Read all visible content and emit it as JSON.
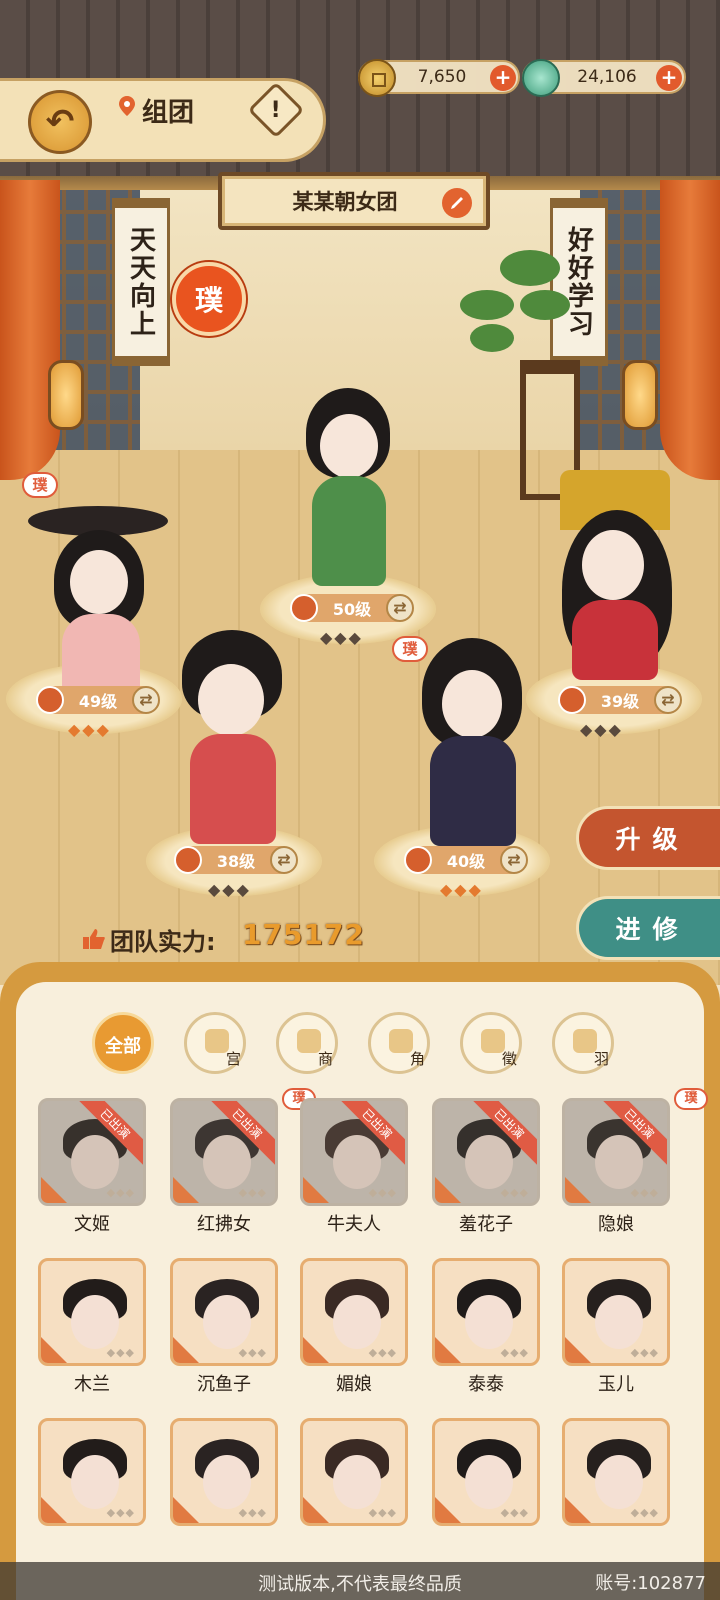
{
  "header": {
    "title": "组团",
    "info_label": "!",
    "back_label": "↶"
  },
  "currency": {
    "coins": "7,650",
    "jade": "24,106",
    "plus": "+"
  },
  "team": {
    "name": "某某朝女团",
    "power_label": "团队实力:",
    "power_value": "175172"
  },
  "scenery": {
    "scroll_left": "天天向上",
    "scroll_right": "好好学习",
    "seal": "璞"
  },
  "lineup": [
    {
      "level": "50级",
      "stars": 3
    },
    {
      "level": "49级",
      "stars": 3
    },
    {
      "level": "39级",
      "stars": 3
    },
    {
      "level": "38级",
      "stars": 3
    },
    {
      "level": "40级",
      "stars": 3
    }
  ],
  "pu_tag": "璞",
  "actions": {
    "upgrade": "升级",
    "train": "进修"
  },
  "filters": [
    {
      "label": "全部"
    },
    {
      "label": "宫"
    },
    {
      "label": "商"
    },
    {
      "label": "角"
    },
    {
      "label": "徵"
    },
    {
      "label": "羽"
    }
  ],
  "roster": [
    {
      "name": "文姬",
      "status": "已出演",
      "pu": false
    },
    {
      "name": "红拂女",
      "status": "已出演",
      "pu": true
    },
    {
      "name": "牛夫人",
      "status": "已出演",
      "pu": false
    },
    {
      "name": "羞花子",
      "status": "已出演",
      "pu": false
    },
    {
      "name": "隐娘",
      "status": "已出演",
      "pu": true
    },
    {
      "name": "木兰",
      "status": "",
      "pu": false
    },
    {
      "name": "沉鱼子",
      "status": "",
      "pu": false
    },
    {
      "name": "媚娘",
      "status": "",
      "pu": false
    },
    {
      "name": "泰泰",
      "status": "",
      "pu": false
    },
    {
      "name": "玉儿",
      "status": "",
      "pu": false
    },
    {
      "name": "",
      "status": "",
      "pu": false
    },
    {
      "name": "",
      "status": "",
      "pu": false
    },
    {
      "name": "",
      "status": "",
      "pu": false
    },
    {
      "name": "",
      "status": "",
      "pu": false
    },
    {
      "name": "",
      "status": "",
      "pu": false
    }
  ],
  "star_glyph": "◆◆◆",
  "footer": {
    "watermark": "测试版本,不代表最终品质",
    "account": "账号:102877"
  }
}
